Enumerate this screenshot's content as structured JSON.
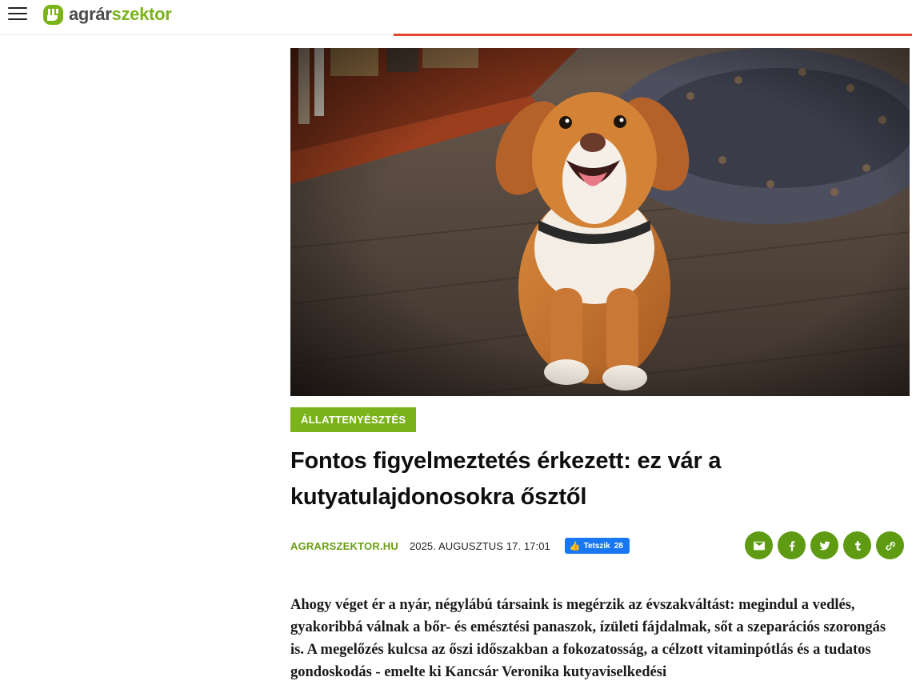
{
  "header": {
    "logo_part1": "agrár",
    "logo_part2": "szektor",
    "brand_color": "#7bb31a",
    "progress_color": "#e2462f"
  },
  "hero": {
    "alt": "kutya"
  },
  "article": {
    "category": "ÁLLATTENYÉSZTÉS",
    "title": "Fontos figyelmeztetés érkezett: ez vár a kutyatulajdonosokra ősztől",
    "source": "AGRARSZEKTOR.HU",
    "date": "2025. AUGUSZTUS 17. 17:01",
    "like_label": "Tetszik",
    "like_count": "28",
    "lead": "Ahogy véget ér a nyár, négylábú társaink is megérzik az évszakváltást: megindul a vedlés, gyakoribbá válnak a bőr- és emésztési panaszok, ízületi fájdalmak, sőt a szeparációs szorongás is. A megelőzés kulcsa az őszi időszakban a fokozatosság, a célzott vitaminpótlás és a tudatos gondoskodás - emelte ki Kancsár Veronika kutyaviselkedési"
  },
  "share_icons": [
    "email-icon",
    "facebook-icon",
    "twitter-icon",
    "tumblr-icon",
    "link-icon"
  ],
  "colors": {
    "share_bg": "#5f9b12",
    "fb_blue": "#1877f2"
  }
}
